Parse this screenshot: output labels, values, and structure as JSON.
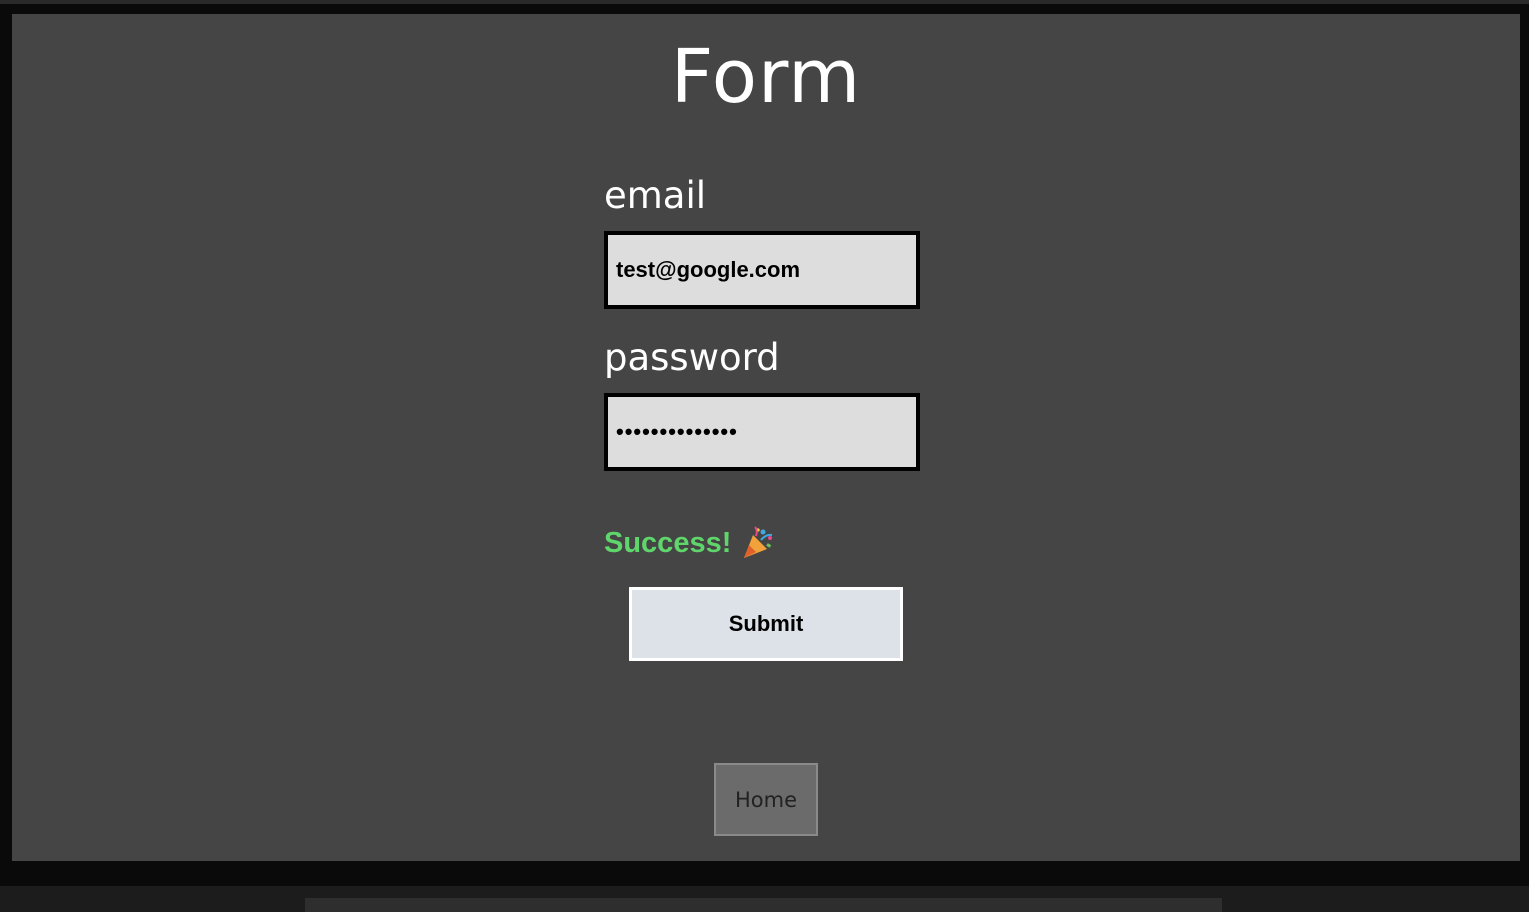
{
  "page": {
    "title": "Form"
  },
  "form": {
    "email": {
      "label": "email",
      "value": "test@google.com"
    },
    "password": {
      "label": "password",
      "value": "••••••••••••••"
    },
    "status": {
      "text": "Success!",
      "icon": "party-popper-icon",
      "color": "#5fd66b"
    },
    "submit_label": "Submit"
  },
  "nav": {
    "home_label": "Home"
  },
  "colors": {
    "screen_background": "#454545",
    "input_background": "#dddddd",
    "submit_background": "#dde2e8",
    "home_background": "#6b6b6b"
  }
}
